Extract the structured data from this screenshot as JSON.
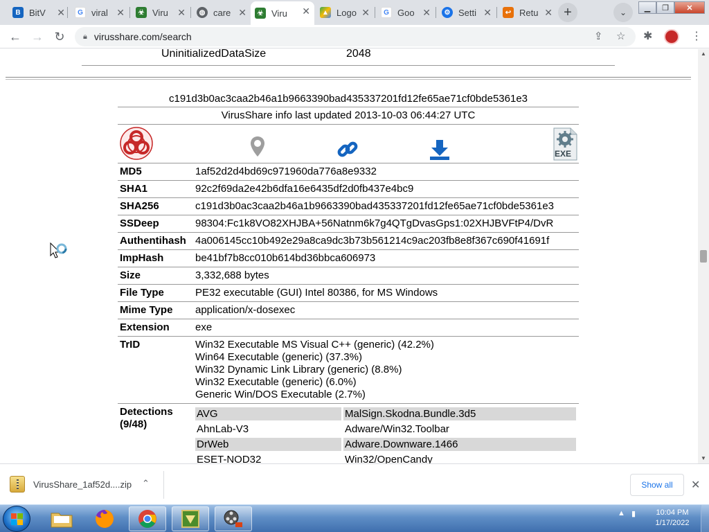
{
  "browser": {
    "tabs": [
      {
        "title": "BitV",
        "favicon": "bitvise-icon",
        "color": "#1565c0"
      },
      {
        "title": "viral",
        "favicon": "google-icon",
        "color": "#4285f4"
      },
      {
        "title": "Viru",
        "favicon": "virusshare-icon",
        "color": "#2e7d32"
      },
      {
        "title": "care",
        "favicon": "globe-icon",
        "color": "#5f6368"
      },
      {
        "title": "Viru",
        "favicon": "virusshare-icon",
        "color": "#2e7d32",
        "active": true
      },
      {
        "title": "Logo",
        "favicon": "google-drive-icon",
        "color": "#fbbc04"
      },
      {
        "title": "Goo",
        "favicon": "google-icon",
        "color": "#4285f4"
      },
      {
        "title": "Setti",
        "favicon": "settings-gear-icon",
        "color": "#1a73e8"
      },
      {
        "title": "Retu",
        "favicon": "returns-icon",
        "color": "#e8710a"
      }
    ],
    "url": "virusshare.com/search"
  },
  "page": {
    "uninit_key": "UninitializedDataSize",
    "uninit_val": "2048",
    "sha_header": "c191d3b0ac3caa2b46a1b9663390bad435337201fd12fe65ae71cf0bde5361e3",
    "updated": "VirusShare info last updated 2013-10-03 06:44:27 UTC",
    "exe_label": "EXE",
    "rows": [
      {
        "key": "MD5",
        "val": "1af52d2d4bd69c971960da776a8e9332"
      },
      {
        "key": "SHA1",
        "val": "92c2f69da2e42b6dfa16e6435df2d0fb437e4bc9"
      },
      {
        "key": "SHA256",
        "val": "c191d3b0ac3caa2b46a1b9663390bad435337201fd12fe65ae71cf0bde5361e3"
      },
      {
        "key": "SSDeep",
        "val": "98304:Fc1k8VO82XHJBA+56Natnm6k7g4QTgDvasGps1:02XHJBVFtP4/DvR"
      },
      {
        "key": "Authentihash",
        "val": "4a006145cc10b492e29a8ca9dc3b73b561214c9ac203fb8e8f367c690f41691f"
      },
      {
        "key": "ImpHash",
        "val": "be41bf7b8cc010b614bd36bbca606973"
      },
      {
        "key": "Size",
        "val": "3,332,688 bytes"
      },
      {
        "key": "File Type",
        "val": "PE32 executable (GUI) Intel 80386, for MS Windows"
      },
      {
        "key": "Mime Type",
        "val": "application/x-dosexec"
      },
      {
        "key": "Extension",
        "val": "exe"
      }
    ],
    "trid": {
      "key": "TrID",
      "lines": [
        "Win32 Executable MS Visual C++ (generic) (42.2%)",
        "Win64 Executable (generic) (37.3%)",
        "Win32 Dynamic Link Library (generic) (8.8%)",
        "Win32 Executable (generic) (6.0%)",
        "Generic Win/DOS Executable (2.7%)"
      ]
    },
    "detections": {
      "key": "Detections",
      "count": "(9/48)",
      "items": [
        {
          "av": "AVG",
          "result": "MalSign.Skodna.Bundle.3d5"
        },
        {
          "av": "AhnLab-V3",
          "result": "Adware/Win32.Toolbar"
        },
        {
          "av": "DrWeb",
          "result": "Adware.Downware.1466"
        },
        {
          "av": "ESET-NOD32",
          "result": "Win32/OpenCandy"
        }
      ]
    }
  },
  "download": {
    "filename": "VirusShare_1af52d....zip",
    "show_all": "Show all"
  },
  "taskbar": {
    "time": "10:04 PM",
    "date": "1/17/2022"
  },
  "colors": {
    "biohazard": "#c62828",
    "link_blue": "#1565c0",
    "pin_gray": "#9e9e9e"
  }
}
